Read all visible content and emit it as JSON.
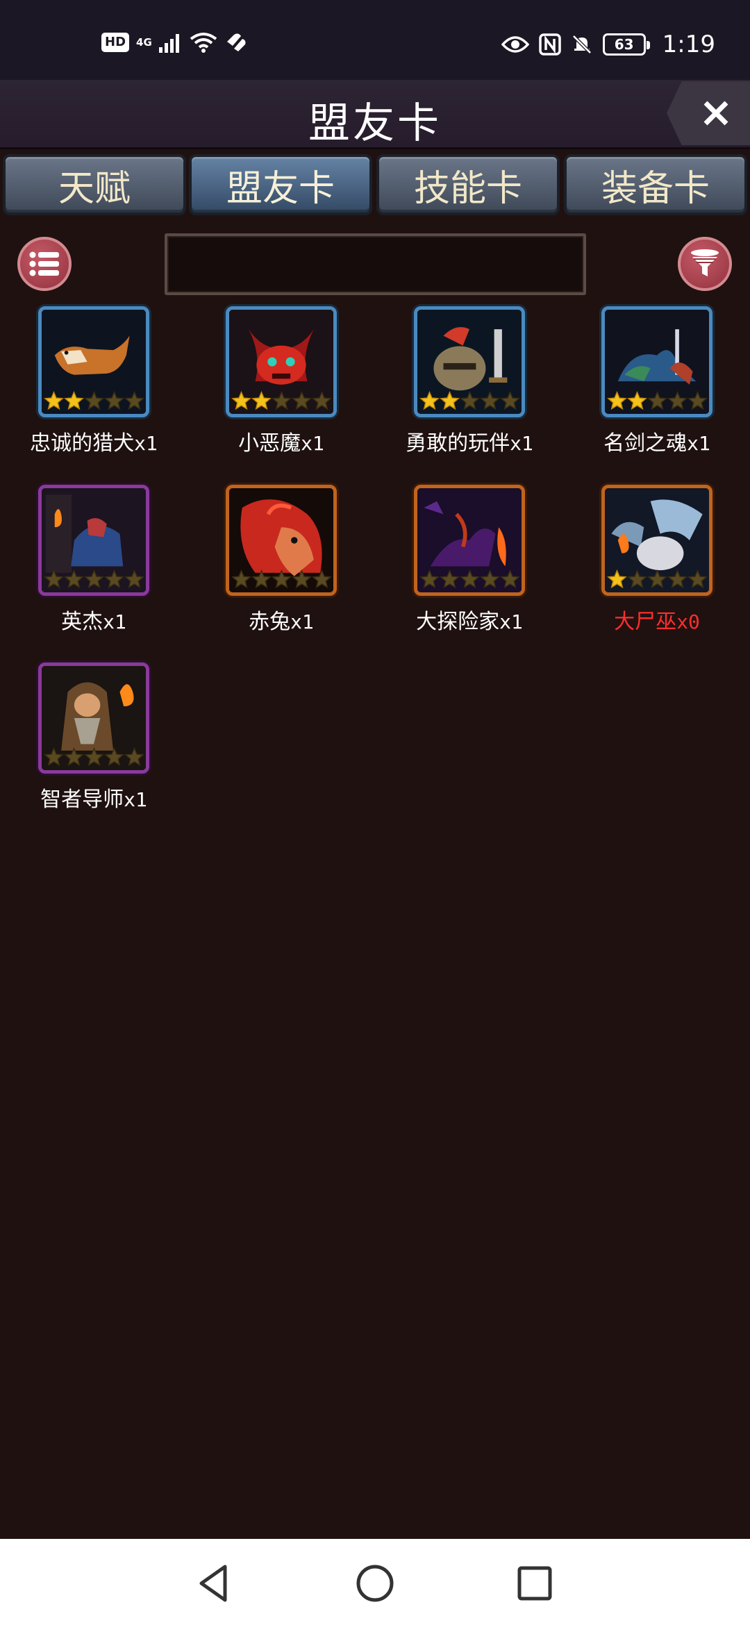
{
  "status_bar": {
    "hd": "HD",
    "network": "4G",
    "battery": "63",
    "time": "1:19"
  },
  "header": {
    "title": "盟友卡"
  },
  "tabs": [
    {
      "label": "天赋",
      "active": false
    },
    {
      "label": "盟友卡",
      "active": true
    },
    {
      "label": "技能卡",
      "active": false
    },
    {
      "label": "装备卡",
      "active": false
    }
  ],
  "search": {
    "value": "",
    "placeholder": ""
  },
  "cards": [
    {
      "name": "忠诚的猎犬",
      "qty": "x1",
      "stars": 2,
      "rarity": "blue",
      "art": "hound"
    },
    {
      "name": "小恶魔",
      "qty": "x1",
      "stars": 2,
      "rarity": "blue",
      "art": "imp"
    },
    {
      "name": "勇敢的玩伴",
      "qty": "x1",
      "stars": 2,
      "rarity": "blue",
      "art": "knight"
    },
    {
      "name": "名剑之魂",
      "qty": "x1",
      "stars": 2,
      "rarity": "blue",
      "art": "sword-spirit"
    },
    {
      "name": "英杰",
      "qty": "x1",
      "stars": 0,
      "rarity": "purple",
      "art": "hero"
    },
    {
      "name": "赤兔",
      "qty": "x1",
      "stars": 0,
      "rarity": "orange",
      "art": "red-horse"
    },
    {
      "name": "大探险家",
      "qty": "x1",
      "stars": 0,
      "rarity": "orange",
      "art": "dragon"
    },
    {
      "name": "大尸巫",
      "qty": "x0",
      "stars": 1,
      "rarity": "orange",
      "art": "lich",
      "unowned": true
    },
    {
      "name": "智者导师",
      "qty": "x1",
      "stars": 0,
      "rarity": "purple",
      "art": "sage"
    }
  ],
  "colors": {
    "background": "#1f1110",
    "unowned_text": "#ff2e2e",
    "star_filled": "#f5c21b",
    "star_empty": "#5a4a22"
  }
}
